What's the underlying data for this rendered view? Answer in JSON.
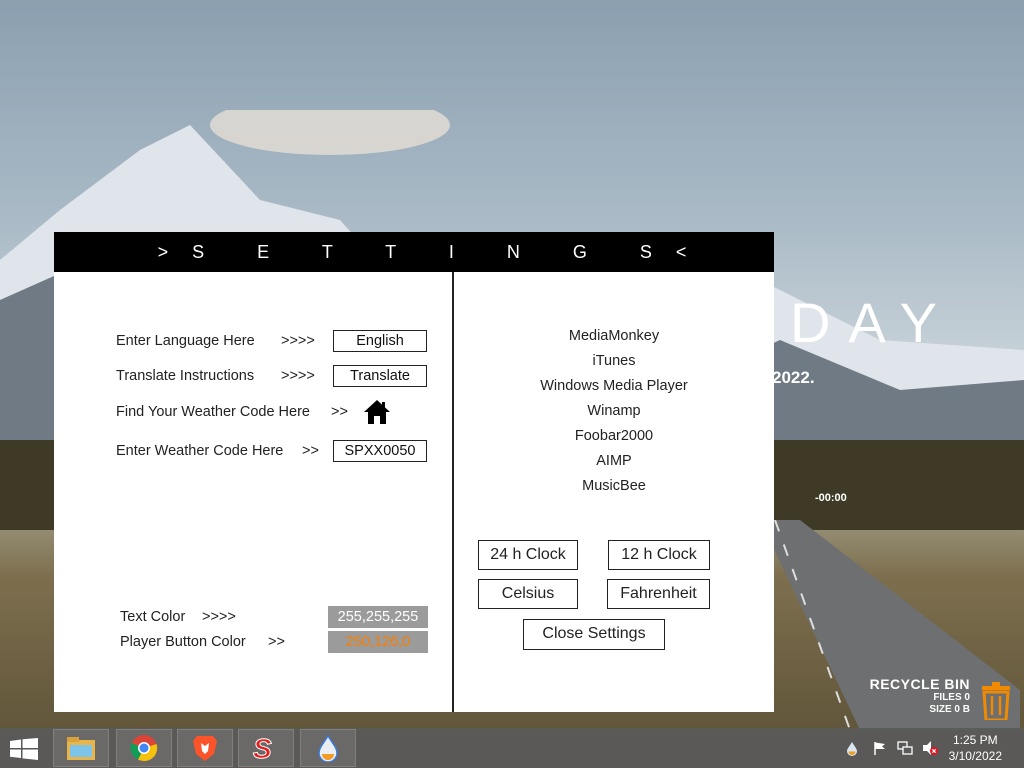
{
  "desktop": {
    "big_word": "DAY",
    "date_fragment": "2022.",
    "time_fragment": "-00:00",
    "recycle_bin": {
      "title": "RECYCLE BIN",
      "files": "FILES 0",
      "size": "SIZE 0 B"
    }
  },
  "settings": {
    "title": ">S E T T I N G S<",
    "language": {
      "label": "Enter Language Here",
      "arrow": ">>>>",
      "value": "English"
    },
    "translate": {
      "label": "Translate Instructions",
      "arrow": ">>>>",
      "button": "Translate"
    },
    "weather_find": {
      "label": "Find Your Weather Code Here",
      "arrow": ">>",
      "icon": "home-icon"
    },
    "weather_code": {
      "label": "Enter Weather Code Here",
      "arrow": ">>",
      "value": "SPXX0050"
    },
    "text_color": {
      "label": "Text Color",
      "arrow": ">>>>",
      "value": "255,255,255"
    },
    "player_button_color": {
      "label": "Player Button Color",
      "arrow": ">>",
      "value": "250,126,0",
      "color": "#fa7e00"
    },
    "players": [
      "MediaMonkey",
      "iTunes",
      "Windows Media Player",
      "Winamp",
      "Foobar2000",
      "AIMP",
      "MusicBee"
    ],
    "buttons": {
      "clock24": "24 h Clock",
      "clock12": "12 h Clock",
      "celsius": "Celsius",
      "fahrenheit": "Fahrenheit",
      "close": "Close Settings"
    }
  },
  "taskbar": {
    "apps": [
      "file-explorer-icon",
      "chrome-icon",
      "brave-icon",
      "s-app-icon",
      "droplet-app-icon"
    ],
    "clock": {
      "time": "1:25 PM",
      "date": "3/10/2022"
    }
  }
}
